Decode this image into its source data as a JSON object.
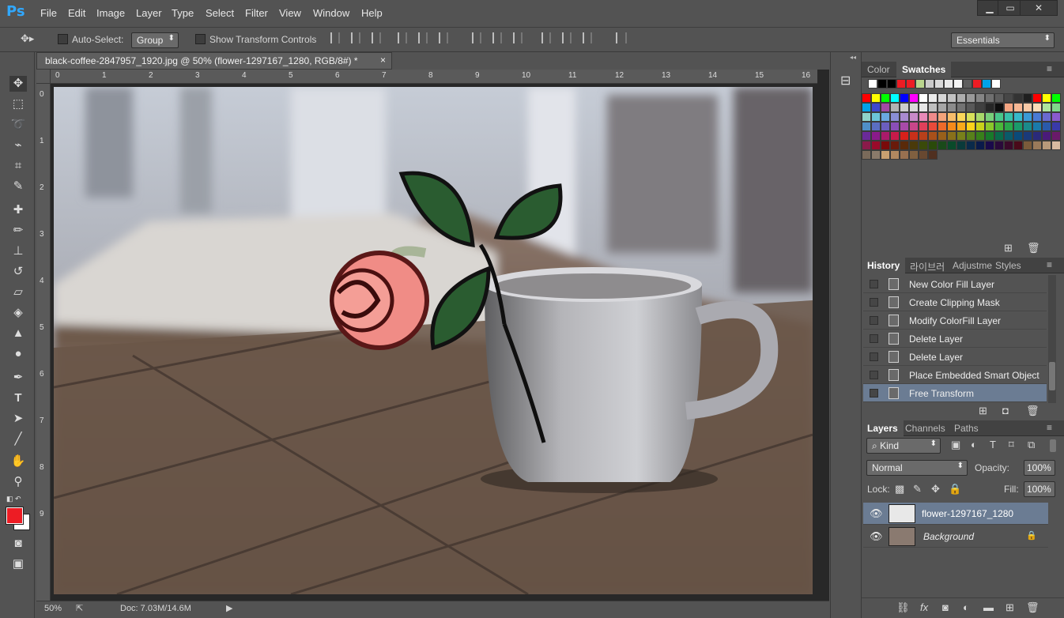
{
  "app": {
    "logo": "Ps",
    "workspace": "Essentials"
  },
  "menu": [
    "File",
    "Edit",
    "Image",
    "Layer",
    "Type",
    "Select",
    "Filter",
    "View",
    "Window",
    "Help"
  ],
  "window_controls": [
    "▁",
    "▭",
    "✕"
  ],
  "options": {
    "auto_select_label": "Auto-Select:",
    "group_value": "Group",
    "transform_label": "Show Transform Controls"
  },
  "document": {
    "tab_title": "black-coffee-2847957_1920.jpg @ 50% (flower-1297167_1280, RGB/8#) *",
    "close": "×"
  },
  "ruler_h": [
    "0",
    "1",
    "2",
    "3",
    "4",
    "5",
    "6",
    "7",
    "8",
    "9",
    "10",
    "11",
    "12",
    "13",
    "14",
    "15",
    "16"
  ],
  "ruler_v": [
    "0",
    "1",
    "2",
    "3",
    "4",
    "5",
    "6",
    "7",
    "8",
    "9"
  ],
  "status": {
    "zoom": "50%",
    "doc": "Doc: 7.03M/14.6M"
  },
  "color_panel": {
    "tabs": [
      "Color",
      "Swatches"
    ],
    "active": "Swatches"
  },
  "swatch_colors": {
    "top": [
      "#ffffff",
      "#000000",
      "#000000",
      "#ed1c24",
      "#ed1c24",
      "#b9d48d",
      "#c9c9c9",
      "#d9d9d9",
      "#e9e9e9",
      "#f5f5f5",
      "#5e5e5e",
      "#ed1c24",
      "#00a2e8",
      "#ffffff"
    ],
    "rows": [
      [
        "#ff0000",
        "#ffff00",
        "#00ff00",
        "#00ffff",
        "#0000ff",
        "#ff00ff",
        "#ffffff",
        "#ebebeb",
        "#d6d6d6",
        "#c2c2c2",
        "#adadad",
        "#999999",
        "#858585",
        "#707070",
        "#5c5c5c",
        "#474747",
        "#333333",
        "#1f1f1f",
        "#ff0000",
        "#ffff00",
        "#00ff00"
      ],
      [
        "#00a2e8",
        "#3f48cc",
        "#a349a4",
        "#b3b3b3",
        "#cccccc",
        "#d9d9d9",
        "#e6e6e6",
        "#bfbfbf",
        "#a6a6a6",
        "#8c8c8c",
        "#737373",
        "#595959",
        "#404040",
        "#262626",
        "#0d0d0d",
        "#f4a582",
        "#f7b794",
        "#f9c9a6",
        "#fbdbb8",
        "#aee59d",
        "#7fd88a"
      ],
      [
        "#8fd3c9",
        "#6cc4d8",
        "#6aa8e0",
        "#8a8fd6",
        "#a98ad0",
        "#c88ac8",
        "#e88ab8",
        "#ef8a8a",
        "#f3a37a",
        "#f7bd6a",
        "#fbd75a",
        "#d8e05a",
        "#a8d86a",
        "#78cf7a",
        "#48c68a",
        "#38bfaa",
        "#38b8ca",
        "#3b9ad6",
        "#4a7ad4",
        "#6a6ad0",
        "#8a5ace"
      ],
      [
        "#4f8fc8",
        "#5a6ec2",
        "#6b5ebe",
        "#8a4eb8",
        "#a84aa8",
        "#c8468a",
        "#e0405a",
        "#e84a3a",
        "#ee6a2a",
        "#f48a1a",
        "#f8aa1a",
        "#fcd21a",
        "#c8d21a",
        "#8ac82a",
        "#4ab83a",
        "#2aa84a",
        "#1a9a6a",
        "#1a8a8a",
        "#1a7aaa",
        "#2a5aaa",
        "#3a3aaa"
      ],
      [
        "#6a2a9a",
        "#8a1a8a",
        "#aa1a6a",
        "#c81a4a",
        "#d8201a",
        "#c8301a",
        "#b8401a",
        "#a8501a",
        "#98601a",
        "#88701a",
        "#78801a",
        "#58801a",
        "#38801a",
        "#187a2a",
        "#0a6a4a",
        "#0a5a6a",
        "#0a4a7a",
        "#1a3a7a",
        "#2a2a7a",
        "#4a1a7a",
        "#6a1a6a"
      ],
      [
        "#8a1a4a",
        "#9a0a2a",
        "#7a0a0a",
        "#6a1a0a",
        "#5a2a0a",
        "#4a3a0a",
        "#3a4a0a",
        "#2a4a0a",
        "#1a4a1a",
        "#0a4a2a",
        "#0a3a3a",
        "#0a2a4a",
        "#0a1a4a",
        "#1a0a4a",
        "#2a0a3a",
        "#3a0a2a",
        "#4a0a1a",
        "#7a5a3a",
        "#9a7a5a",
        "#b89a7a",
        "#d8baa0"
      ],
      [
        "#7a6a5a",
        "#8a7a6a",
        "#c8a070",
        "#b08860",
        "#987050",
        "#806040",
        "#684830",
        "#503020"
      ]
    ]
  },
  "history_panel": {
    "tabs": [
      "History",
      "라이브러",
      "Adjustme",
      "Styles"
    ],
    "active": "History",
    "items": [
      "New Color Fill Layer",
      "Create Clipping Mask",
      "Modify ColorFill Layer",
      "Delete Layer",
      "Delete Layer",
      "Place Embedded Smart Object",
      "Free Transform"
    ],
    "selected_index": 6
  },
  "layers_panel": {
    "tabs": [
      "Layers",
      "Channels",
      "Paths"
    ],
    "active": "Layers",
    "filter_kind": "Kind",
    "blend_mode": "Normal",
    "opacity_label": "Opacity:",
    "opacity": "100%",
    "lock_label": "Lock:",
    "fill_label": "Fill:",
    "fill": "100%",
    "layers": [
      {
        "name": "flower-1297167_1280",
        "selected": true
      },
      {
        "name": "Background",
        "selected": false
      }
    ],
    "footer_icons": [
      "link",
      "fx",
      "mask",
      "adjustment",
      "folder",
      "new",
      "trash"
    ]
  },
  "colors": {
    "foreground": "#ed1c24",
    "background": "#ffffff",
    "selected": "#6b7c93",
    "app_bg": "#535353"
  }
}
